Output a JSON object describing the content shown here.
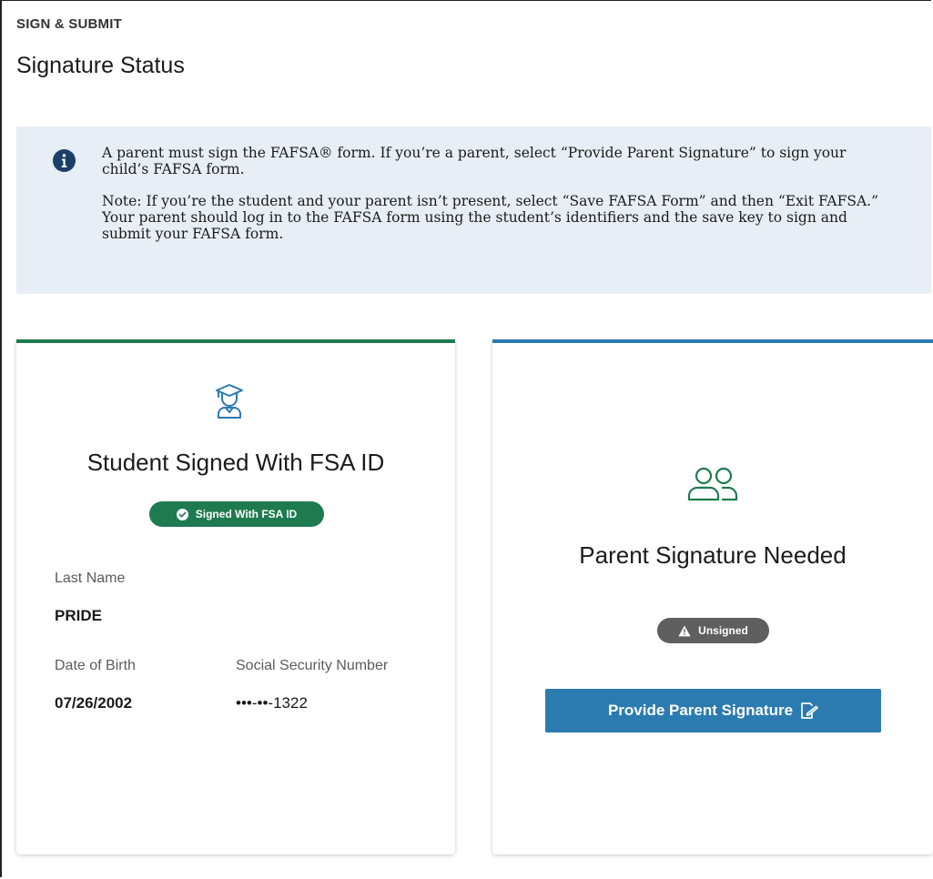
{
  "header": {
    "eyebrow": "SIGN & SUBMIT",
    "title": "Signature Status"
  },
  "alert": {
    "icon": "info-icon",
    "paragraph1": "A parent must sign the FAFSA® form. If you’re a parent, select “Provide Parent Signature” to sign your child’s FAFSA form.",
    "paragraph2": "Note: If you’re the student and your parent isn’t present, select “Save FAFSA Form” and then “Exit FAFSA.” Your parent should log in to the FAFSA form using the student’s identifiers and the save key to sign and submit your FAFSA form."
  },
  "student_card": {
    "icon": "graduate-icon",
    "title": "Student Signed With FSA ID",
    "badge": "Signed With FSA ID",
    "last_name_label": "Last Name",
    "last_name_value": "PRIDE",
    "dob_label": "Date of Birth",
    "dob_value": "07/26/2002",
    "ssn_label": "Social Security Number",
    "ssn_value": "•••-••-1322"
  },
  "parent_card": {
    "icon": "users-icon",
    "title": "Parent Signature Needed",
    "badge": "Unsigned",
    "button_label": "Provide Parent Signature"
  },
  "colors": {
    "green": "#1e7b4f",
    "blue": "#2b7bb0",
    "gray_badge": "#5f5f5f",
    "alert_bg": "#e8eef5",
    "info_icon": "#1b3f66"
  }
}
